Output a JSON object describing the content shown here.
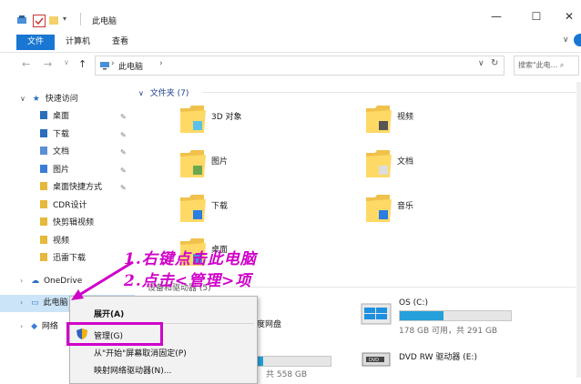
{
  "window": {
    "title": "此电脑",
    "buttons": {
      "minimize": "—",
      "maximize": "☐",
      "close": "✕"
    }
  },
  "ribbon": {
    "tabs": [
      "文件",
      "计算机",
      "查看"
    ],
    "expand": "∨"
  },
  "address": {
    "path": "此电脑",
    "search_placeholder": "搜索\"此电...  ⌕"
  },
  "nav": {
    "quick_access": "快速访问",
    "items": [
      {
        "label": "桌面",
        "pinned": true
      },
      {
        "label": "下载",
        "pinned": true
      },
      {
        "label": "文档",
        "pinned": true
      },
      {
        "label": "图片",
        "pinned": true
      },
      {
        "label": "桌面快捷方式",
        "pinned": true
      },
      {
        "label": "CDR设计",
        "pinned": false
      },
      {
        "label": "快剪辑视频",
        "pinned": false
      },
      {
        "label": "视频",
        "pinned": false
      },
      {
        "label": "迅雷下载",
        "pinned": false
      }
    ],
    "onedrive": "OneDrive",
    "this_pc": "此电脑",
    "network": "网络"
  },
  "content": {
    "folders_header": "文件夹 (7)",
    "folders": [
      "3D 对象",
      "视频",
      "图片",
      "文档",
      "下载",
      "音乐",
      "桌面"
    ],
    "devices_header_partial": "设备和驱动器 (5)",
    "drives": [
      {
        "name": "OS (C:)",
        "size": "178 GB 可用，共 291 GB",
        "used_fraction": 0.39
      },
      {
        "name": "DVD RW 驱动器 (E:)"
      }
    ],
    "partial_labels": {
      "cloud_disk": "度网盘",
      "left_size": "共 558 GB"
    }
  },
  "context_menu": {
    "items": [
      "展开(A)",
      "管理(G)",
      "从\"开始\"屏幕取消固定(P)",
      "映射网络驱动器(N)..."
    ]
  },
  "annotations": {
    "line1": "1.右键点击此电脑",
    "line2": "2.点击<管理>项"
  },
  "colors": {
    "accent": "#1976d2",
    "annotation": "#d000c9",
    "drive_fill": "#26a0da",
    "header_text": "#1e3f8c"
  }
}
